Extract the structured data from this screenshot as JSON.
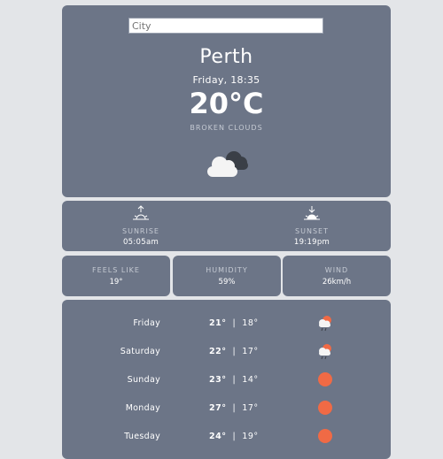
{
  "search": {
    "placeholder": "City"
  },
  "current": {
    "city": "Perth",
    "datetime": "Friday, 18:35",
    "temperature": "20°C",
    "condition": "BROKEN CLOUDS",
    "icon": "broken-clouds-icon"
  },
  "sun": {
    "sunrise_label": "SUNRISE",
    "sunrise_time": "05:05am",
    "sunset_label": "SUNSET",
    "sunset_time": "19:19pm"
  },
  "stats": [
    {
      "label": "FEELS LIKE",
      "value": "19°"
    },
    {
      "label": "HUMIDITY",
      "value": "59%"
    },
    {
      "label": "WIND",
      "value": "26km/h"
    }
  ],
  "forecast": [
    {
      "day": "Friday",
      "high": "21°",
      "sep": "|",
      "low": "18°",
      "icon": "sun-cloud-rain-icon"
    },
    {
      "day": "Saturday",
      "high": "22°",
      "sep": "|",
      "low": "17°",
      "icon": "sun-cloud-rain-icon"
    },
    {
      "day": "Sunday",
      "high": "23°",
      "sep": "|",
      "low": "14°",
      "icon": "sun-icon"
    },
    {
      "day": "Monday",
      "high": "27°",
      "sep": "|",
      "low": "17°",
      "icon": "sun-icon"
    },
    {
      "day": "Tuesday",
      "high": "24°",
      "sep": "|",
      "low": "19°",
      "icon": "sun-icon"
    }
  ],
  "colors": {
    "background": "#e3e5e8",
    "card": "#6c7587",
    "sun_accent": "#f06a45"
  }
}
